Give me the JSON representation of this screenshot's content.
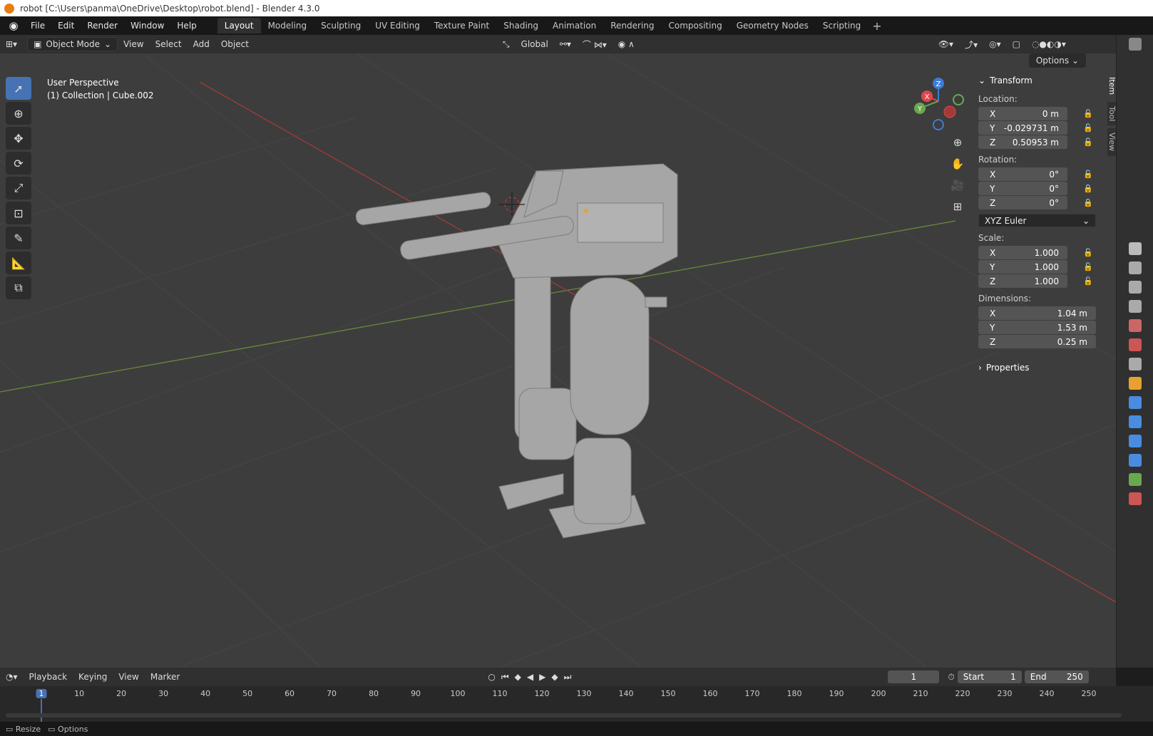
{
  "window_title": "robot [C:\\Users\\panma\\OneDrive\\Desktop\\robot.blend] - Blender 4.3.0",
  "menus": [
    "File",
    "Edit",
    "Render",
    "Window",
    "Help"
  ],
  "workspace_tabs": [
    "Layout",
    "Modeling",
    "Sculpting",
    "UV Editing",
    "Texture Paint",
    "Shading",
    "Animation",
    "Rendering",
    "Compositing",
    "Geometry Nodes",
    "Scripting"
  ],
  "active_workspace": "Layout",
  "viewport_header": {
    "mode": "Object Mode",
    "menus": [
      "View",
      "Select",
      "Add",
      "Object"
    ],
    "orientation": "Global",
    "options_label": "Options"
  },
  "viewport_info": {
    "perspective": "User Perspective",
    "collection": "(1) Collection | Cube.002"
  },
  "gizmo_axes": {
    "x": "X",
    "y": "Y",
    "z": "Z"
  },
  "transform_panel": {
    "title": "Transform",
    "location_label": "Location:",
    "location": [
      {
        "axis": "X",
        "value": "0 m"
      },
      {
        "axis": "Y",
        "value": "-0.029731 m"
      },
      {
        "axis": "Z",
        "value": "0.50953 m"
      }
    ],
    "rotation_label": "Rotation:",
    "rotation": [
      {
        "axis": "X",
        "value": "0°"
      },
      {
        "axis": "Y",
        "value": "0°"
      },
      {
        "axis": "Z",
        "value": "0°"
      }
    ],
    "rotation_mode": "XYZ Euler",
    "scale_label": "Scale:",
    "scale": [
      {
        "axis": "X",
        "value": "1.000"
      },
      {
        "axis": "Y",
        "value": "1.000"
      },
      {
        "axis": "Z",
        "value": "1.000"
      }
    ],
    "dimensions_label": "Dimensions:",
    "dimensions": [
      {
        "axis": "X",
        "value": "1.04 m"
      },
      {
        "axis": "Y",
        "value": "1.53 m"
      },
      {
        "axis": "Z",
        "value": "0.25 m"
      }
    ],
    "properties_label": "Properties"
  },
  "side_tabs": [
    "Item",
    "Tool",
    "View"
  ],
  "timeline": {
    "menus": [
      "Playback",
      "Keying",
      "View",
      "Marker"
    ],
    "current_frame": "1",
    "start_label": "Start",
    "start": "1",
    "end_label": "End",
    "end": "250",
    "ticks": [
      "1",
      "10",
      "20",
      "30",
      "40",
      "50",
      "60",
      "70",
      "80",
      "90",
      "100",
      "110",
      "120",
      "130",
      "140",
      "150",
      "160",
      "170",
      "180",
      "190",
      "200",
      "210",
      "220",
      "230",
      "240",
      "250"
    ]
  },
  "statusbar": {
    "resize": "Resize",
    "options": "Options"
  },
  "colors": {
    "accent": "#4772b3",
    "x_axis": "#e0464d",
    "y_axis": "#6aa84f",
    "z_axis": "#3d7bd6"
  }
}
